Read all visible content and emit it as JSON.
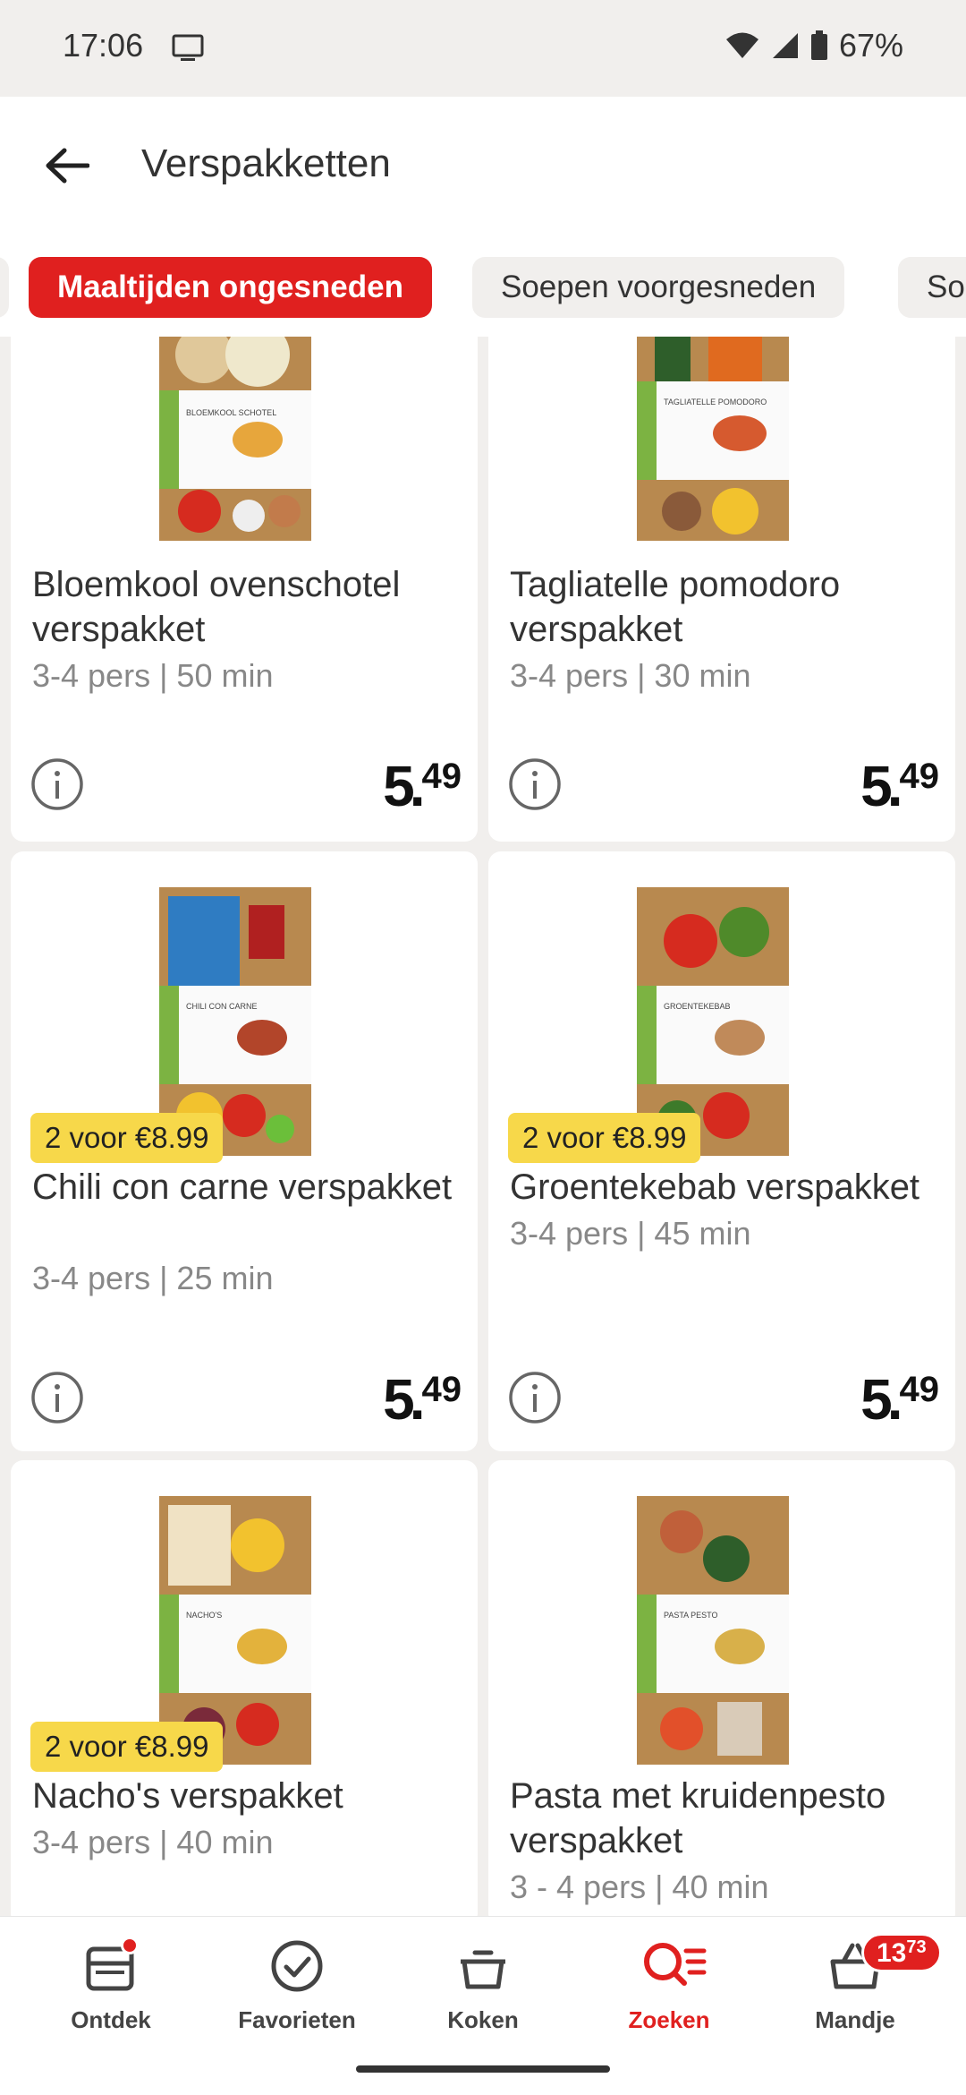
{
  "status_bar": {
    "time": "17:06",
    "battery": "67%"
  },
  "header": {
    "title": "Verspakketten"
  },
  "chips": [
    {
      "label": "Maaltijden ongesneden"
    },
    {
      "label": "Soepen voorgesneden"
    },
    {
      "label": "So"
    }
  ],
  "products": [
    {
      "name": "Bloemkool ovenschotel verspakket",
      "meta": "3-4 pers | 50 min",
      "price_int": "5",
      "price_dec": "49",
      "promo": "",
      "package_label": "BLOEMKOOL SCHOTEL"
    },
    {
      "name": "Tagliatelle pomodoro verspakket",
      "meta": "3-4 pers | 30 min",
      "price_int": "5",
      "price_dec": "49",
      "promo": "",
      "package_label": "TAGLIATELLE POMODORO"
    },
    {
      "name": "Chili con carne verspakket",
      "meta": "3-4 pers | 25 min",
      "price_int": "5",
      "price_dec": "49",
      "promo": "2 voor €8.99",
      "package_label": "CHILI CON CARNE"
    },
    {
      "name": "Groentekebab verspakket",
      "meta": "3-4 pers | 45 min",
      "price_int": "5",
      "price_dec": "49",
      "promo": "2 voor €8.99",
      "package_label": "GROENTEKEBAB"
    },
    {
      "name": "Nacho's verspakket",
      "meta": "3-4 pers | 40 min",
      "price_int": "",
      "price_dec": "",
      "promo": "2 voor €8.99",
      "package_label": "NACHO'S"
    },
    {
      "name": "Pasta met kruidenpesto verspakket",
      "meta": "3 - 4 pers |  40 min",
      "price_int": "",
      "price_dec": "",
      "promo": "",
      "package_label": "PASTA PESTO"
    }
  ],
  "nav": [
    {
      "label": "Ontdek",
      "icon": "discover-icon"
    },
    {
      "label": "Favorieten",
      "icon": "check-circle-icon"
    },
    {
      "label": "Koken",
      "icon": "cooking-pot-icon"
    },
    {
      "label": "Zoeken",
      "icon": "search-list-icon"
    },
    {
      "label": "Mandje",
      "icon": "basket-icon"
    }
  ],
  "cart": {
    "total_int": "13",
    "total_dec": "73"
  },
  "colors": {
    "brand_red": "#e0201f",
    "promo_yellow": "#f7d84a",
    "background": "#f1efed"
  }
}
